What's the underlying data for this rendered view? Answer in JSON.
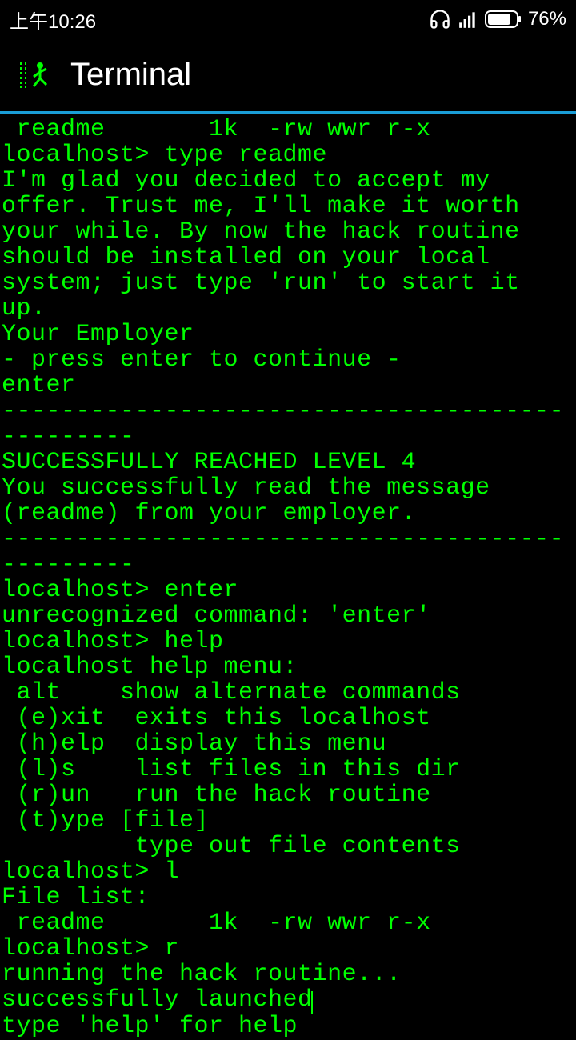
{
  "status_bar": {
    "time": "上午10:26",
    "battery_pct": "76%"
  },
  "header": {
    "title": "Terminal"
  },
  "terminal": {
    "lines": [
      " readme       1k  -rw wwr r-x",
      "localhost> type readme",
      "I'm glad you decided to accept my offer. Trust me, I'll make it worth your while. By now the hack routine should be installed on your local system; just type 'run' to start it up.",
      "Your Employer",
      "- press enter to continue -",
      "enter",
      "-----------------------------------------------",
      "SUCCESSFULLY REACHED LEVEL 4",
      "You successfully read the message (readme) from your employer.",
      "-----------------------------------------------",
      "localhost> enter",
      "unrecognized command: 'enter'",
      "localhost> help",
      "localhost help menu:",
      " alt    show alternate commands",
      " (e)xit  exits this localhost",
      " (h)elp  display this menu",
      " (l)s    list files in this dir",
      " (r)un   run the hack routine",
      " (t)ype [file]",
      "         type out file contents",
      "localhost> l",
      "File list:",
      " readme       1k  -rw wwr r-x",
      "localhost> r",
      "running the hack routine...",
      "successfully launched",
      "type 'help' for help"
    ],
    "cursor_line_index": 26
  }
}
